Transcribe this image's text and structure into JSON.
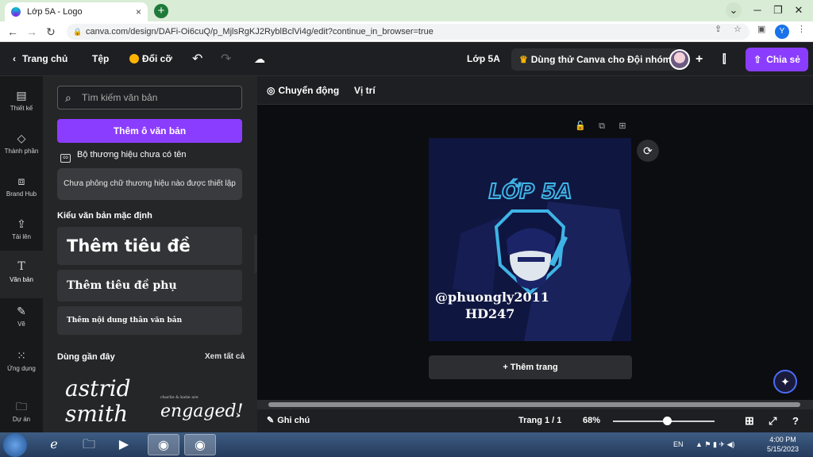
{
  "browser": {
    "tab_title": "Lớp 5A - Logo",
    "tab_close": "×",
    "new_tab": "+",
    "url": "canva.com/design/DAFi-Oi6cuQ/p_MjlsRgKJ2RyblBclVi4g/edit?continue_in_browser=true",
    "profile_initial": "Y"
  },
  "topbar": {
    "home": "Trang chủ",
    "file": "Tệp",
    "resize": "Đổi cỡ",
    "design_title": "Lớp 5A",
    "trial": "Dùng thử Canva cho Đội nhóm",
    "share": "Chia sẻ"
  },
  "rail": [
    {
      "label": "Thiết kế",
      "icon": "layout-icon"
    },
    {
      "label": "Thành phần",
      "icon": "shapes-icon"
    },
    {
      "label": "Brand Hub",
      "icon": "brand-icon"
    },
    {
      "label": "Tải lên",
      "icon": "upload-icon"
    },
    {
      "label": "Văn bản",
      "icon": "text-icon"
    },
    {
      "label": "Vẽ",
      "icon": "draw-icon"
    },
    {
      "label": "Ứng dụng",
      "icon": "apps-icon"
    },
    {
      "label": "Dự án",
      "icon": "folder-icon"
    }
  ],
  "panel": {
    "search_placeholder": "Tìm kiếm văn bản",
    "add_textbox": "Thêm ô văn bản",
    "brand_kit": "Bộ thương hiệu chưa có tên",
    "no_brand_fonts": "Chưa phông chữ thương hiệu nào được thiết lập",
    "default_styles_title": "Kiểu văn bản mặc định",
    "heading": "Thêm tiêu đề",
    "subheading": "Thêm tiêu đề phụ",
    "body": "Thêm nội dung thân văn bản",
    "recent_title": "Dùng gần đây",
    "see_all": "Xem tất cả",
    "recent_1_line1": "astrid",
    "recent_1_line2": "smith",
    "recent_2_small": "charlie & katie are",
    "recent_2": "engaged!"
  },
  "context_bar": {
    "animate": "Chuyển động",
    "position": "Vị trí"
  },
  "design": {
    "title": "LỚP 5A",
    "handle": "@phuongly2011",
    "code": "HD247",
    "colors": {
      "background": "#0f1640",
      "accent": "#3fb4e6"
    }
  },
  "canvas": {
    "add_page": "+ Thêm trang"
  },
  "bottombar": {
    "notes": "Ghi chú",
    "page_indicator": "Trang 1 / 1",
    "zoom": "68%",
    "zoom_level": 0.68
  },
  "taskbar": {
    "lang": "EN",
    "time": "4:00 PM",
    "date": "5/15/2023"
  }
}
